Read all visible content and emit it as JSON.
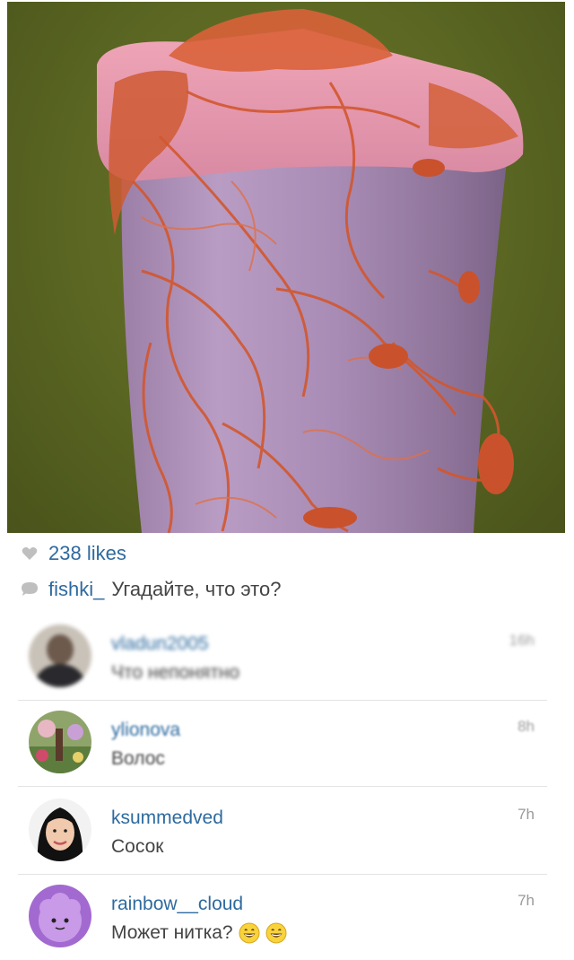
{
  "post": {
    "likes": "238 likes",
    "caption_user": "fishki_",
    "caption_text": "Угадайте, что это?",
    "icons": {
      "likes": "heart-icon",
      "caption": "speech-bubble-icon"
    }
  },
  "comments": [
    {
      "user": "vladun2005",
      "text": "Что непонятно",
      "time": "16h",
      "avatar": "dark-figure-avatar"
    },
    {
      "user": "ylionova",
      "text": "Волос",
      "time": "8h",
      "avatar": "colorful-scene-avatar"
    },
    {
      "user": "ksummedved",
      "text": "Сосок",
      "time": "7h",
      "avatar": "woman-portrait-avatar"
    },
    {
      "user": "rainbow__cloud",
      "text": "Может нитка?",
      "time": "7h",
      "avatar": "purple-cartoon-avatar",
      "emoji": [
        "grinning-face-emoji",
        "grinning-face-emoji"
      ]
    }
  ],
  "colors": {
    "link": "#2d6a9f",
    "text": "#444444",
    "time": "#9a9a9a"
  }
}
